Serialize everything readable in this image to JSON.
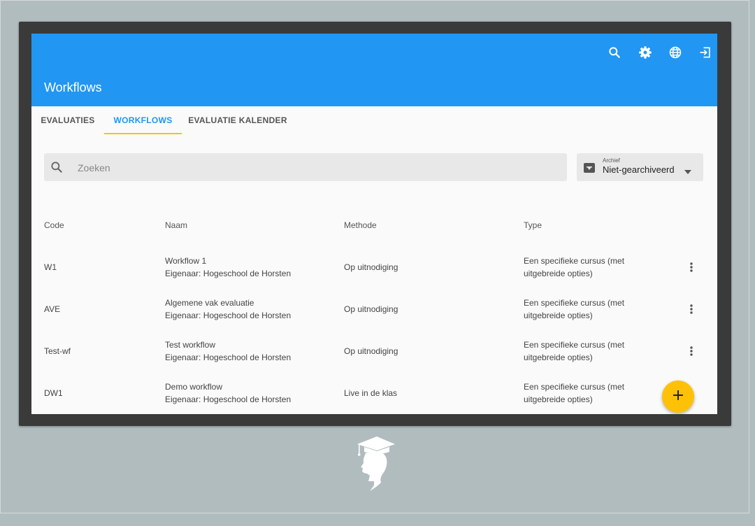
{
  "appbar": {
    "title": "Workflows",
    "icons": [
      "search-icon",
      "gear-icon",
      "globe-icon",
      "logout-icon"
    ]
  },
  "tabs": [
    {
      "label": "EVALUATIES"
    },
    {
      "label": "WORKFLOWS",
      "active": true
    },
    {
      "label": "EVALUATIE KALENDER"
    }
  ],
  "search": {
    "placeholder": "Zoeken",
    "value": ""
  },
  "archive_filter": {
    "label": "Archief",
    "value": "Niet-gearchiveerd"
  },
  "table": {
    "columns": [
      "Code",
      "Naam",
      "Methode",
      "Type"
    ],
    "rows": [
      {
        "code": "W1",
        "name": "Workflow 1",
        "owner": "Eigenaar: Hogeschool de Horsten",
        "method": "Op uitnodiging",
        "type_line1": "Een specifieke cursus (met",
        "type_line2": "uitgebreide opties)"
      },
      {
        "code": "AVE",
        "name": "Algemene vak evaluatie",
        "owner": "Eigenaar: Hogeschool de Horsten",
        "method": "Op uitnodiging",
        "type_line1": "Een specifieke cursus (met",
        "type_line2": "uitgebreide opties)"
      },
      {
        "code": "Test-wf",
        "name": "Test workflow",
        "owner": "Eigenaar: Hogeschool de Horsten",
        "method": "Op uitnodiging",
        "type_line1": "Een specifieke cursus (met",
        "type_line2": "uitgebreide opties)"
      },
      {
        "code": "DW1",
        "name": "Demo workflow",
        "owner": "Eigenaar: Hogeschool de Horsten",
        "method": "Live in de klas",
        "type_line1": "Een specifieke cursus (met",
        "type_line2": "uitgebreide opties)"
      }
    ]
  },
  "fab": {
    "icon": "plus-icon"
  },
  "colors": {
    "primary": "#2196f3",
    "accent": "#ffc107",
    "background": "#b1bcbf"
  }
}
